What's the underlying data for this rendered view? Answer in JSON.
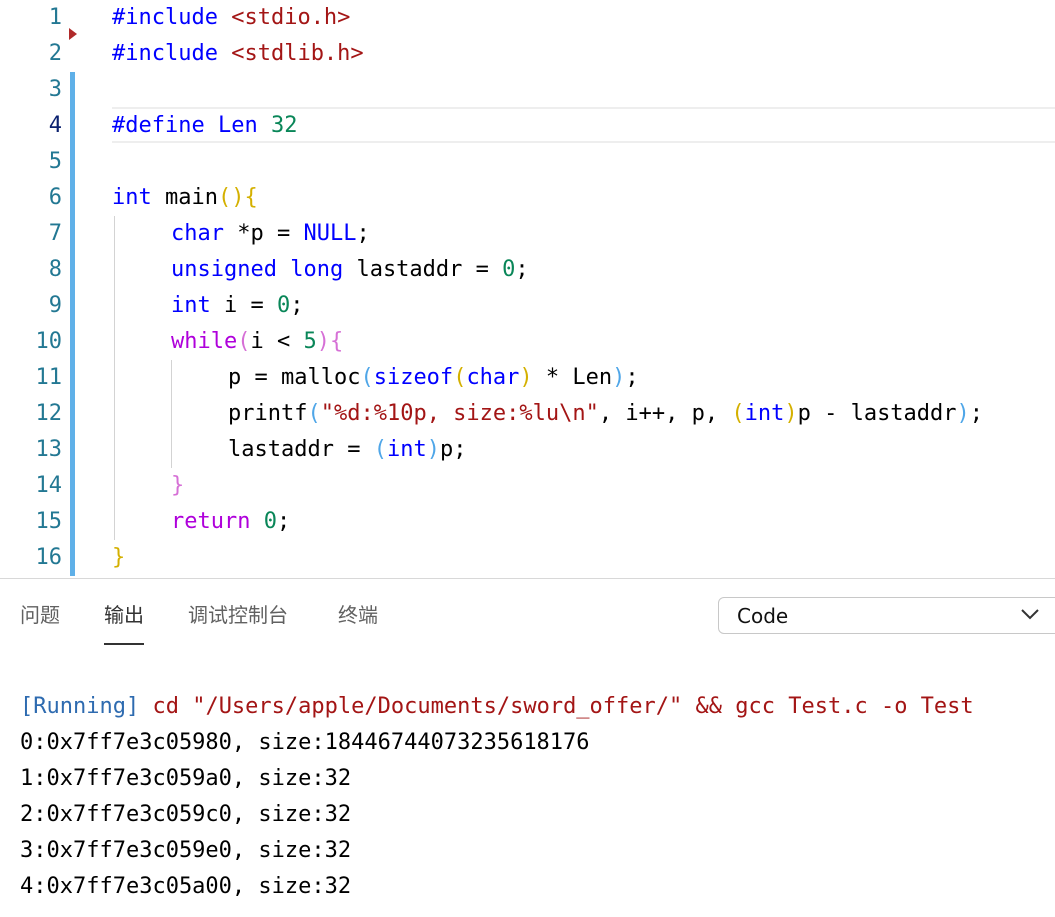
{
  "editor": {
    "lines": [
      {
        "n": "1",
        "tokens": [
          {
            "t": "#include ",
            "c": "kw"
          },
          {
            "t": "<stdio.h>",
            "c": "str"
          }
        ]
      },
      {
        "n": "2",
        "tokens": [
          {
            "t": "#include ",
            "c": "kw"
          },
          {
            "t": "<stdlib.h>",
            "c": "str"
          }
        ]
      },
      {
        "n": "3",
        "tokens": []
      },
      {
        "n": "4",
        "tokens": [
          {
            "t": "#define ",
            "c": "kw"
          },
          {
            "t": "Len ",
            "c": "kw"
          },
          {
            "t": "32",
            "c": "num"
          }
        ]
      },
      {
        "n": "5",
        "tokens": []
      },
      {
        "n": "6",
        "tokens": [
          {
            "t": "int",
            "c": "kw"
          },
          {
            "t": " main",
            "c": "fn"
          },
          {
            "t": "()",
            "c": "b1"
          },
          {
            "t": "{",
            "c": "b1"
          }
        ]
      },
      {
        "n": "7",
        "tokens": [
          {
            "t": "char",
            "c": "kw"
          },
          {
            "t": " *p = ",
            "c": ""
          },
          {
            "t": "NULL",
            "c": "kw"
          },
          {
            "t": ";",
            "c": ""
          }
        ]
      },
      {
        "n": "8",
        "tokens": [
          {
            "t": "unsigned",
            "c": "kw"
          },
          {
            "t": " ",
            "c": ""
          },
          {
            "t": "long",
            "c": "kw"
          },
          {
            "t": " lastaddr = ",
            "c": ""
          },
          {
            "t": "0",
            "c": "num"
          },
          {
            "t": ";",
            "c": ""
          }
        ]
      },
      {
        "n": "9",
        "tokens": [
          {
            "t": "int",
            "c": "kw"
          },
          {
            "t": " i = ",
            "c": ""
          },
          {
            "t": "0",
            "c": "num"
          },
          {
            "t": ";",
            "c": ""
          }
        ]
      },
      {
        "n": "10",
        "tokens": [
          {
            "t": "while",
            "c": "ctl"
          },
          {
            "t": "(",
            "c": "b2"
          },
          {
            "t": "i < ",
            "c": ""
          },
          {
            "t": "5",
            "c": "num"
          },
          {
            "t": ")",
            "c": "b2"
          },
          {
            "t": "{",
            "c": "b2"
          }
        ]
      },
      {
        "n": "11",
        "tokens": [
          {
            "t": "p = malloc",
            "c": ""
          },
          {
            "t": "(",
            "c": "b3"
          },
          {
            "t": "sizeof",
            "c": "kw"
          },
          {
            "t": "(",
            "c": "b1"
          },
          {
            "t": "char",
            "c": "kw"
          },
          {
            "t": ")",
            "c": "b1"
          },
          {
            "t": " * Len",
            "c": ""
          },
          {
            "t": ")",
            "c": "b3"
          },
          {
            "t": ";",
            "c": ""
          }
        ]
      },
      {
        "n": "12",
        "tokens": [
          {
            "t": "printf",
            "c": ""
          },
          {
            "t": "(",
            "c": "b3"
          },
          {
            "t": "\"%d:%10p, size:%lu\\n\"",
            "c": "str"
          },
          {
            "t": ", i++, p, ",
            "c": ""
          },
          {
            "t": "(",
            "c": "b1"
          },
          {
            "t": "int",
            "c": "kw"
          },
          {
            "t": ")",
            "c": "b1"
          },
          {
            "t": "p - lastaddr",
            "c": ""
          },
          {
            "t": ")",
            "c": "b3"
          },
          {
            "t": ";",
            "c": ""
          }
        ]
      },
      {
        "n": "13",
        "tokens": [
          {
            "t": "lastaddr = ",
            "c": ""
          },
          {
            "t": "(",
            "c": "b3"
          },
          {
            "t": "int",
            "c": "kw"
          },
          {
            "t": ")",
            "c": "b3"
          },
          {
            "t": "p;",
            "c": ""
          }
        ]
      },
      {
        "n": "14",
        "tokens": [
          {
            "t": "}",
            "c": "b2"
          }
        ]
      },
      {
        "n": "15",
        "tokens": [
          {
            "t": "return",
            "c": "ctl"
          },
          {
            "t": " ",
            "c": ""
          },
          {
            "t": "0",
            "c": "num"
          },
          {
            "t": ";",
            "c": ""
          }
        ]
      },
      {
        "n": "16",
        "tokens": [
          {
            "t": "}",
            "c": "b1"
          }
        ]
      }
    ],
    "active_line": "4",
    "colors": {
      "keyword": "#0000ff",
      "control": "#af00db",
      "string": "#a31515",
      "number": "#098658",
      "line_number": "#237893",
      "modified_bar": "#5fb0e8"
    }
  },
  "panel": {
    "tabs": [
      {
        "label": "问题",
        "active": false
      },
      {
        "label": "输出",
        "active": true
      },
      {
        "label": "调试控制台",
        "active": false
      },
      {
        "label": "终端",
        "active": false
      }
    ],
    "channel_select": {
      "value": "Code",
      "icon": "chevron-down-icon"
    },
    "output": {
      "running_tag": "[Running]",
      "command": " cd \"/Users/apple/Documents/sword_offer/\" && gcc Test.c -o Test",
      "lines": [
        "0:0x7ff7e3c05980, size:18446744073235618176",
        "1:0x7ff7e3c059a0, size:32",
        "2:0x7ff7e3c059c0, size:32",
        "3:0x7ff7e3c059e0, size:32",
        "4:0x7ff7e3c05a00, size:32"
      ]
    }
  }
}
